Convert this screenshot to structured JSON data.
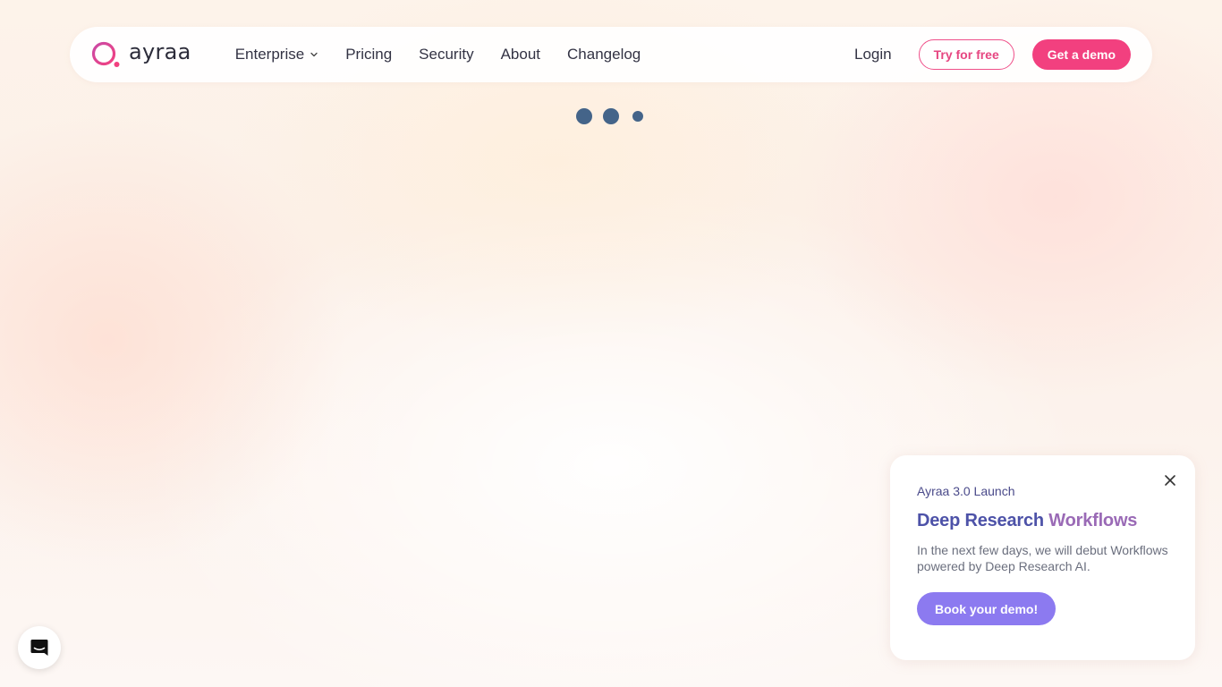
{
  "brand": {
    "name": "ayraa",
    "accent": "#f2407f",
    "logo_icon": "ring-dot-logo-icon"
  },
  "nav": {
    "items": [
      {
        "label": "Enterprise",
        "has_dropdown": true,
        "icon": "chevron-down-icon"
      },
      {
        "label": "Pricing"
      },
      {
        "label": "Security"
      },
      {
        "label": "About"
      },
      {
        "label": "Changelog"
      }
    ],
    "login_label": "Login",
    "try_label": "Try for free",
    "demo_label": "Get a demo"
  },
  "loader": {
    "icon": "loading-dots-icon",
    "color": "#446489"
  },
  "popup": {
    "eyebrow": "Ayraa 3.0 Launch",
    "title_part1": "Deep Research",
    "title_part2": "Workflows",
    "body": "In the next few days, we will debut Workflows powered by Deep Research AI.",
    "button_label": "Book your demo!",
    "close_icon": "close-icon",
    "button_color": "#8c7af0"
  },
  "chat": {
    "icon": "chat-bubble-icon"
  }
}
